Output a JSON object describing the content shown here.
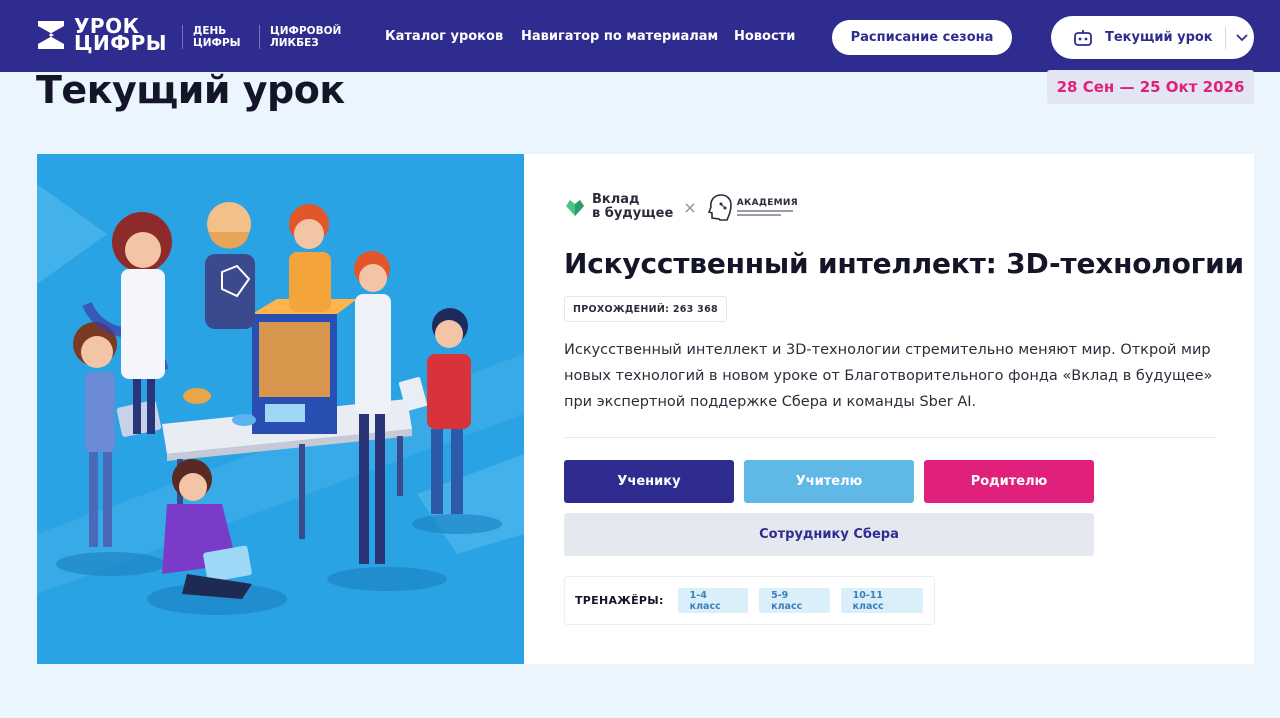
{
  "header": {
    "logo_line1": "УРОК",
    "logo_line2": "ЦИФРЫ",
    "sublogo1_line1": "ДЕНЬ",
    "sublogo1_line2": "ЦИФРЫ",
    "sublogo2_line1": "ЦИФРОВОЙ",
    "sublogo2_line2": "ЛИКБЕЗ",
    "nav": [
      {
        "label": "Каталог уроков"
      },
      {
        "label": "Навигатор по материалам"
      },
      {
        "label": "Новости"
      }
    ],
    "schedule_button": "Расписание сезона",
    "current_lesson_button": "Текущий урок",
    "robot_icon": "robot-icon",
    "chevron_icon": "chevron-down-icon"
  },
  "page": {
    "title": "Текущий урок",
    "date_range": "28 Сен — 25 Окт 2026"
  },
  "lesson": {
    "partner1_line1": "Вклад",
    "partner1_line2": "в будущее",
    "partner_separator": "×",
    "partner2": "АКАДЕМИЯ",
    "title": "Искусственный интеллект: 3D-технологии",
    "passes": "ПРОХОЖДЕНИЙ: 263 368",
    "description": "Искусственный интеллект и 3D-технологии стремительно меняют мир. Открой мир новых технологий в новом уроке от Благотворительного фонда «Вклад в будущее» при экспертной поддержке Сбера и команды Sber AI.",
    "roles": {
      "student": "Ученику",
      "teacher": "Учителю",
      "parent": "Родителю",
      "sber": "Сотруднику Сбера"
    },
    "trainers_label": "ТРЕНАЖЁРЫ:",
    "grades": [
      "1-4 класс",
      "5-9 класс",
      "10-11 класс"
    ]
  },
  "colors": {
    "header_bg": "#2f2c8f",
    "page_bg": "#eaf5fd",
    "accent_pink": "#e0207a",
    "student_btn": "#2f2c8f",
    "teacher_btn": "#5fb8e6",
    "parent_btn": "#e0207a",
    "illustration_bg": "#2aa3e4"
  }
}
